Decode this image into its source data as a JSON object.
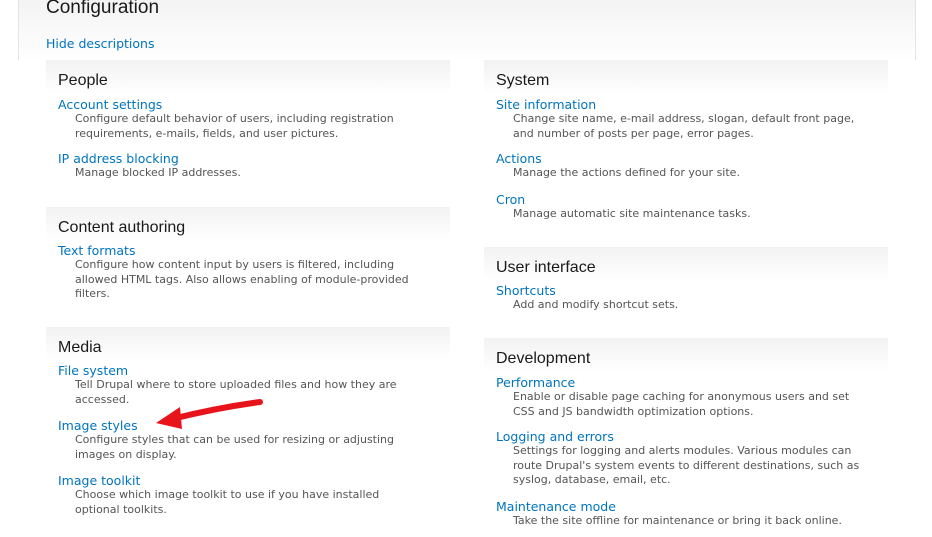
{
  "page": {
    "title": "Configuration",
    "hide_descriptions": "Hide descriptions"
  },
  "colors": {
    "link": "#0074bd",
    "annotation_arrow": "#e8141b"
  },
  "left_panels": [
    {
      "title": "People",
      "items": [
        {
          "link": "Account settings",
          "desc": "Configure default behavior of users, including registration requirements, e-mails, fields, and user pictures."
        },
        {
          "link": "IP address blocking",
          "desc": "Manage blocked IP addresses."
        }
      ]
    },
    {
      "title": "Content authoring",
      "items": [
        {
          "link": "Text formats",
          "desc": "Configure how content input by users is filtered, including allowed HTML tags. Also allows enabling of module-provided filters."
        }
      ]
    },
    {
      "title": "Media",
      "items": [
        {
          "link": "File system",
          "desc": "Tell Drupal where to store uploaded files and how they are accessed."
        },
        {
          "link": "Image styles",
          "desc": "Configure styles that can be used for resizing or adjusting images on display."
        },
        {
          "link": "Image toolkit",
          "desc": "Choose which image toolkit to use if you have installed optional toolkits."
        }
      ]
    }
  ],
  "right_panels": [
    {
      "title": "System",
      "items": [
        {
          "link": "Site information",
          "desc": "Change site name, e-mail address, slogan, default front page, and number of posts per page, error pages."
        },
        {
          "link": "Actions",
          "desc": "Manage the actions defined for your site."
        },
        {
          "link": "Cron",
          "desc": "Manage automatic site maintenance tasks."
        }
      ]
    },
    {
      "title": "User interface",
      "items": [
        {
          "link": "Shortcuts",
          "desc": "Add and modify shortcut sets."
        }
      ]
    },
    {
      "title": "Development",
      "items": [
        {
          "link": "Performance",
          "desc": "Enable or disable page caching for anonymous users and set CSS and JS bandwidth optimization options."
        },
        {
          "link": "Logging and errors",
          "desc": "Settings for logging and alerts modules. Various modules can route Drupal's system events to different destinations, such as syslog, database, email, etc."
        },
        {
          "link": "Maintenance mode",
          "desc": "Take the site offline for maintenance or bring it back online."
        }
      ]
    }
  ]
}
